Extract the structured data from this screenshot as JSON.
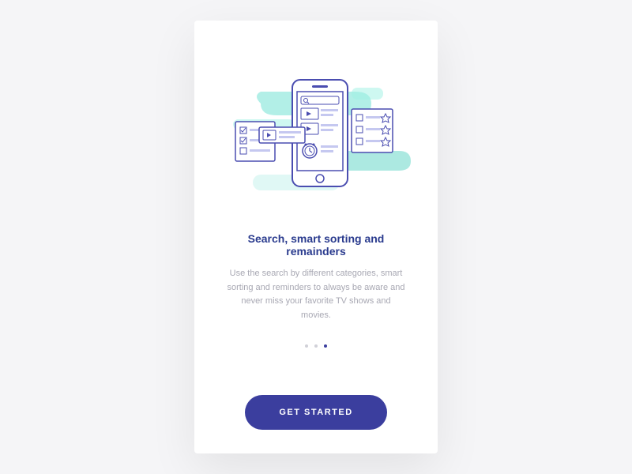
{
  "onboarding": {
    "title": "Search, smart sorting and remainders",
    "description": "Use the search by different categories, smart sorting and reminders to always be aware and never miss your favorite TV shows and movies.",
    "ctaLabel": "GET STARTED",
    "currentPage": 3,
    "totalPages": 3
  },
  "colors": {
    "primary": "#3b3e9e",
    "accent": "#67e0d0",
    "accentLight": "#b8f0e8",
    "textMuted": "#a8a8b3"
  }
}
